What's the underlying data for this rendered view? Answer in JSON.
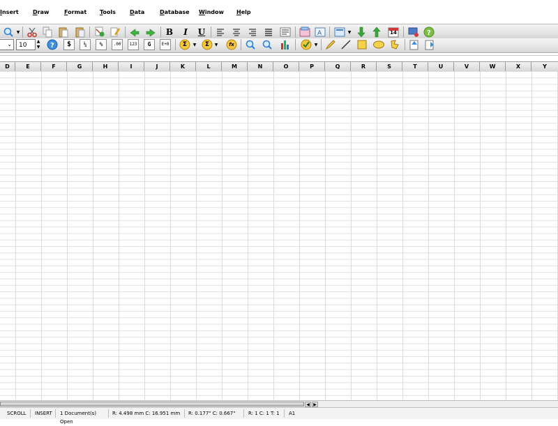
{
  "menu": [
    {
      "mnemonic": "I",
      "rest": "nsert"
    },
    {
      "mnemonic": "D",
      "rest": "raw"
    },
    {
      "mnemonic": "F",
      "rest": "ormat"
    },
    {
      "mnemonic": "T",
      "rest": "ools"
    },
    {
      "mnemonic": "D",
      "rest": "ata"
    },
    {
      "mnemonic": "D",
      "rest": "atabase"
    },
    {
      "mnemonic": "W",
      "rest": "indow"
    },
    {
      "mnemonic": "H",
      "rest": "elp"
    }
  ],
  "toolbar": {
    "bold": "B",
    "italic": "I",
    "underline": "U",
    "font_size": "10",
    "currency": "$",
    "fraction": "¼",
    "percent": "%",
    "decimal": ".00",
    "number_format": "123",
    "general": "G",
    "exponent": "E+0",
    "calendar_day": "14",
    "sum_symbol": "Σ",
    "function_symbol": "fx"
  },
  "columns": [
    "D",
    "E",
    "F",
    "G",
    "H",
    "I",
    "J",
    "K",
    "L",
    "M",
    "N",
    "O",
    "P",
    "Q",
    "R",
    "S",
    "T",
    "U",
    "V",
    "W",
    "X",
    "Y"
  ],
  "status": {
    "scroll": "SCROLL",
    "insert": "INSERT",
    "documents": "1 Document(s) Open",
    "position_mm": "R: 4.498 mm  C: 16.951 mm",
    "position_in": "R: 0.177\"  C: 0.667\"",
    "rct": "R: 1  C: 1  T: 1",
    "cell": "A1"
  }
}
